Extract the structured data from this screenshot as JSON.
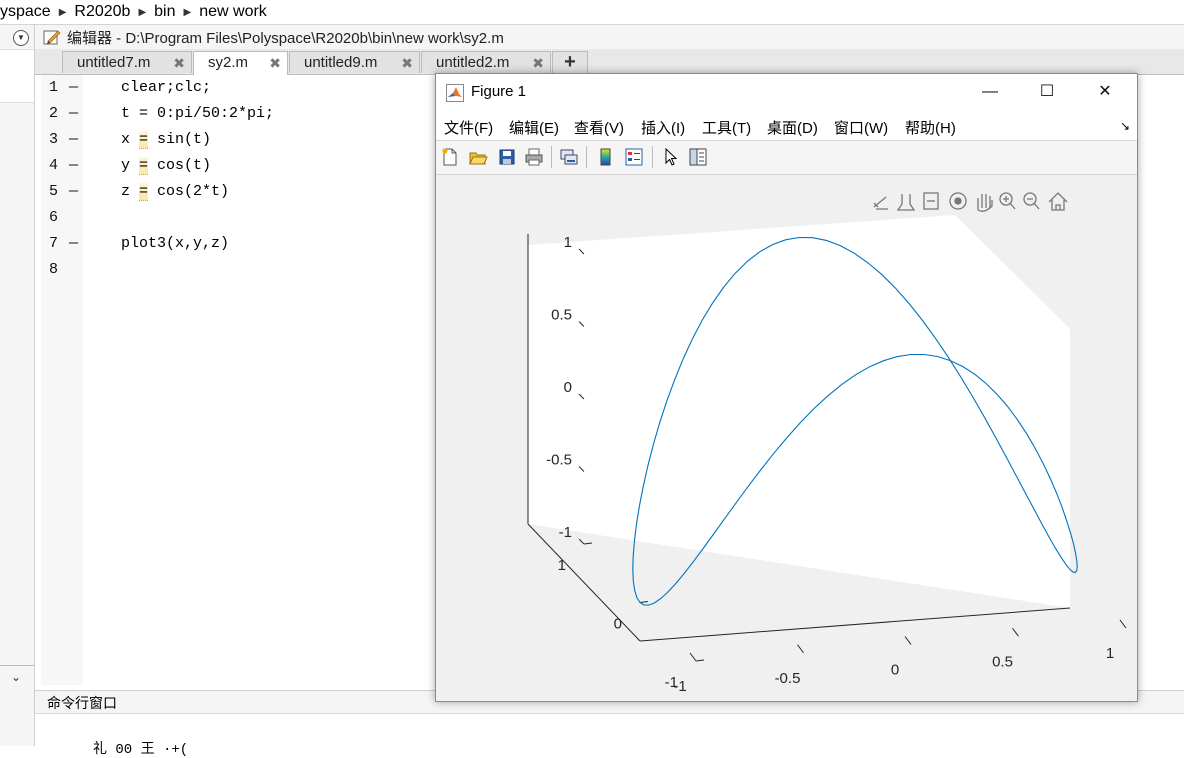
{
  "breadcrumb": [
    "yspace",
    "R2020b",
    "bin",
    "new work"
  ],
  "editor": {
    "title": "编辑器 - D:\\Program Files\\Polyspace\\R2020b\\bin\\new work\\sy2.m",
    "tabs": [
      {
        "label": "untitled7.m",
        "active": false
      },
      {
        "label": "sy2.m",
        "active": true
      },
      {
        "label": "untitled9.m",
        "active": false
      },
      {
        "label": "untitled2.m",
        "active": false
      }
    ],
    "add_tab_label": "+",
    "lines": [
      {
        "num": "1",
        "dash": "—",
        "code": "clear;clc;"
      },
      {
        "num": "2",
        "dash": "—",
        "code": "t = 0:pi/50:2*pi;"
      },
      {
        "num": "3",
        "dash": "—",
        "var": "x",
        "op": "=",
        "rest": " sin(t)"
      },
      {
        "num": "4",
        "dash": "—",
        "var": "y",
        "op": "=",
        "rest": " cos(t)"
      },
      {
        "num": "5",
        "dash": "—",
        "var": "z",
        "op": "=",
        "rest": " cos(2*t)"
      },
      {
        "num": "6",
        "dash": "",
        "code": ""
      },
      {
        "num": "7",
        "dash": "—",
        "code": "plot3(x,y,z)"
      },
      {
        "num": "8",
        "dash": "",
        "code": ""
      }
    ]
  },
  "command_window": {
    "title": "命令行窗口",
    "partial_text": "礼 00 王 ·+("
  },
  "figure": {
    "title": "Figure 1",
    "minimize": "—",
    "maximize": "☐",
    "close": "✕",
    "menu": [
      "文件(F)",
      "编辑(E)",
      "查看(V)",
      "插入(I)",
      "工具(T)",
      "桌面(D)",
      "窗口(W)",
      "帮助(H)"
    ],
    "menu_arrow": "↘",
    "line_color": "#0072BD",
    "chart_data": {
      "type": "line",
      "title": "",
      "series": [
        {
          "name": "",
          "function": "x = sin(t), y = cos(t), z = cos(2*t), t = 0:pi/50:2*pi"
        }
      ],
      "xlim": [
        -1,
        1
      ],
      "ylim": [
        -1,
        1
      ],
      "zlim": [
        -1,
        1
      ],
      "x_ticks": [
        "-1",
        "-0.5",
        "0",
        "0.5",
        "1"
      ],
      "y_ticks": [
        "-1",
        "0",
        "1"
      ],
      "z_ticks": [
        "-1",
        "-0.5",
        "0",
        "0.5",
        "1"
      ],
      "grid": false
    }
  },
  "icons": {
    "breadcrumb_sep": "▶",
    "panel_toggle": "▼",
    "panel_collapse": "⌄",
    "tab_close": "✖"
  }
}
